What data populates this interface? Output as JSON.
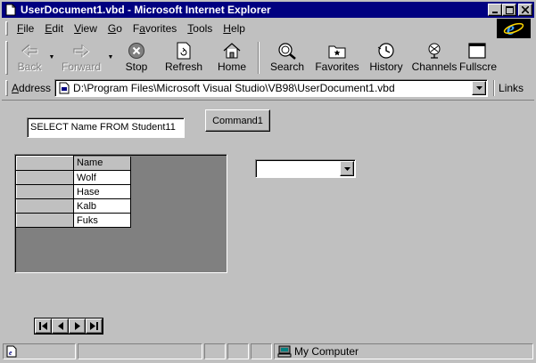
{
  "window": {
    "title": "UserDocument1.vbd - Microsoft Internet Explorer",
    "minimize_glyph": "_",
    "maximize_glyph": "□",
    "close_glyph": "✕"
  },
  "menu": {
    "items": [
      {
        "key": "F",
        "rest": "ile"
      },
      {
        "key": "E",
        "rest": "dit"
      },
      {
        "key": "V",
        "rest": "iew"
      },
      {
        "key": "G",
        "rest": "o"
      },
      {
        "key": "F",
        "rest": "avorites",
        "prefix": "Fa",
        "rest2": "vorites"
      },
      {
        "key": "T",
        "rest": "ools"
      },
      {
        "key": "H",
        "rest": "elp"
      }
    ]
  },
  "toolbar": {
    "back": "Back",
    "forward": "Forward",
    "stop": "Stop",
    "refresh": "Refresh",
    "home": "Home",
    "search": "Search",
    "favorites": "Favorites",
    "history": "History",
    "channels": "Channels",
    "fullscreen": "Fullscre"
  },
  "address": {
    "label_key": "A",
    "label_rest": "ddress",
    "value": "D:\\Program Files\\Microsoft Visual Studio\\VB98\\UserDocument1.vbd",
    "links": "Links"
  },
  "form": {
    "sql_text": "SELECT Name FROM Student11",
    "command_label": "Command1",
    "grid": {
      "header": "Name",
      "rows": [
        "Wolf",
        "Hase",
        "Kalb",
        "Fuks"
      ]
    },
    "combo_value": ""
  },
  "status": {
    "text": "",
    "zone": "My Computer"
  },
  "colors": {
    "titlebar": "#000080",
    "face": "#c0c0c0",
    "grid_background": "#808080"
  }
}
